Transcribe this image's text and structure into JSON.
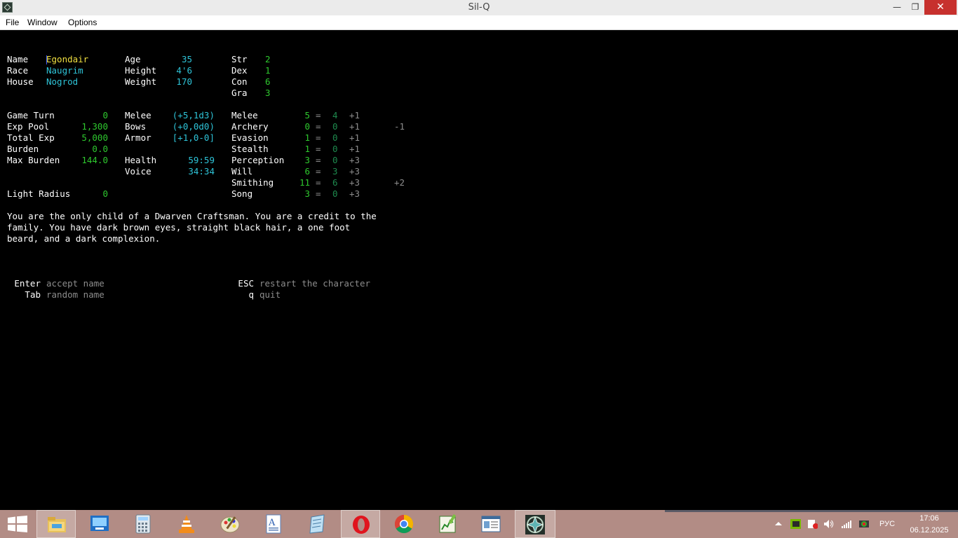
{
  "window": {
    "title": "Sil-Q",
    "minimize": "—",
    "maximize": "❐",
    "close": "✕"
  },
  "menu": {
    "items": [
      "File",
      "Window",
      "Options"
    ]
  },
  "character": {
    "name_label": "Name",
    "name": "Egondair",
    "race_label": "Race",
    "race": "Naugrim",
    "house_label": "House",
    "house": "Nogrod",
    "age_label": "Age",
    "age": "35",
    "height_label": "Height",
    "height": "4'6",
    "weight_label": "Weight",
    "weight": "170",
    "stats": [
      {
        "label": "Str",
        "value": "2"
      },
      {
        "label": "Dex",
        "value": "1"
      },
      {
        "label": "Con",
        "value": "6"
      },
      {
        "label": "Gra",
        "value": "3"
      }
    ],
    "info": [
      {
        "label": "Game Turn",
        "value": "0"
      },
      {
        "label": "Exp Pool",
        "value": "1,300"
      },
      {
        "label": "Total Exp",
        "value": "5,000"
      },
      {
        "label": "Burden",
        "value": "0.0"
      },
      {
        "label": "Max Burden",
        "value": "144.0"
      },
      {
        "label": "Light Radius",
        "value": "0"
      }
    ],
    "combat": [
      {
        "label": "Melee",
        "value": "(+5,1d3)"
      },
      {
        "label": "Bows",
        "value": "(+0,0d0)"
      },
      {
        "label": "Armor",
        "value": "[+1,0-0]"
      },
      {
        "label": "Health",
        "value": "59:59"
      },
      {
        "label": "Voice",
        "value": "34:34"
      }
    ],
    "skills": [
      {
        "label": "Melee",
        "total": "5",
        "eq": "=",
        "base": "4",
        "bonus": "+1",
        "extra": ""
      },
      {
        "label": "Archery",
        "total": "0",
        "eq": "=",
        "base": "0",
        "bonus": "+1",
        "extra": "-1"
      },
      {
        "label": "Evasion",
        "total": "1",
        "eq": "=",
        "base": "0",
        "bonus": "+1",
        "extra": ""
      },
      {
        "label": "Stealth",
        "total": "1",
        "eq": "=",
        "base": "0",
        "bonus": "+1",
        "extra": ""
      },
      {
        "label": "Perception",
        "total": "3",
        "eq": "=",
        "base": "0",
        "bonus": "+3",
        "extra": ""
      },
      {
        "label": "Will",
        "total": "6",
        "eq": "=",
        "base": "3",
        "bonus": "+3",
        "extra": ""
      },
      {
        "label": "Smithing",
        "total": "11",
        "eq": "=",
        "base": "6",
        "bonus": "+3",
        "extra": "+2"
      },
      {
        "label": "Song",
        "total": "3",
        "eq": "=",
        "base": "0",
        "bonus": "+3",
        "extra": ""
      }
    ],
    "history": [
      "You are the only child of a Dwarven Craftsman. You are a credit to the",
      "family. You have dark brown eyes, straight black hair, a one foot",
      "beard, and a dark complexion."
    ]
  },
  "commands": [
    {
      "key": "Enter",
      "desc": "accept name"
    },
    {
      "key": "Tab",
      "desc": "random name"
    },
    {
      "key": "ESC",
      "desc": "restart the character"
    },
    {
      "key": "q",
      "desc": "quit"
    }
  ],
  "taskbar": {
    "apps": [
      "start-button",
      "file-explorer",
      "control-panel",
      "calculator",
      "vlc",
      "paint",
      "wordpad",
      "notepad",
      "opera",
      "chrome",
      "spreadsheet-editor",
      "document-viewer",
      "sil-q"
    ],
    "language": "РУС",
    "time": "17:06",
    "date": "06.12.2025",
    "colors": {
      "taskbar": "#b28c85",
      "close": "#c7312e"
    }
  }
}
